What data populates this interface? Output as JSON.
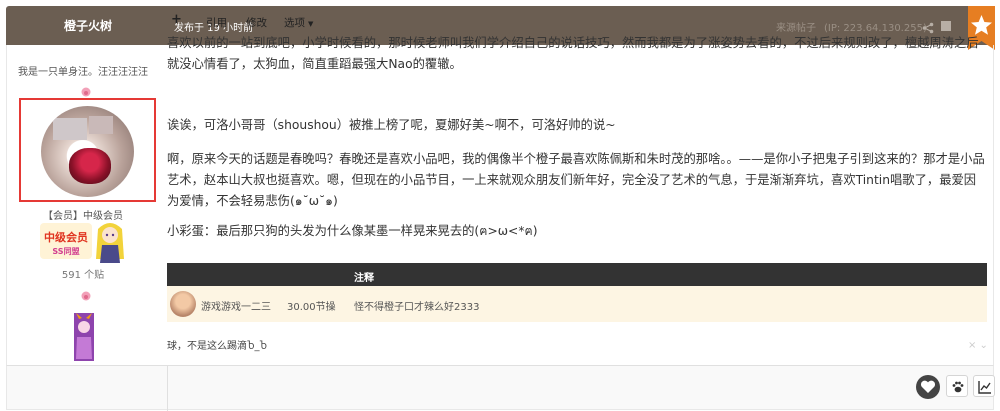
{
  "header": {
    "author": "橙子火树",
    "posted": "发布于 19 小时前",
    "source": "来源帖子",
    "ip": "(IP: 223.64.130.255)",
    "icons": [
      "share-icon",
      "square-icon",
      "bookmark-star-icon"
    ],
    "bookmark_color": "#e67e22",
    "bar_color": "#6b5e52"
  },
  "user": {
    "title": "我是一只单身汪。汪汪汪汪汪",
    "group_prefix": "【会员】",
    "level": "中级会员",
    "rank_badge_text": "中级会员",
    "rank_badge_sub": "SS同盟",
    "posts": "591 个贴",
    "avatar_highlight_color": "#e53935"
  },
  "post": {
    "p1": "喜欢以前的一站到底吧，小学时候看的，那时候老师叫我们学介绍自己的说话技巧，然而我都是为了涨姿势去看的，不过后来规则改了，檀越周涛之后就没心情看了，太狗血，简直重蹈最强大Nao的覆辙。",
    "p2": "诶诶，可洛小哥哥（shoushou）被推上榜了呢，夏娜好美~啊不，可洛好帅的说~",
    "p3": "啊，原来今天的话题是春晚吗？春晚还是喜欢小品吧，我的偶像半个橙子最喜欢陈佩斯和朱时茂的那啥。。——是你小子把鬼子引到这来的？那才是小品艺术，赵本山大叔也挺喜欢。嗯，但现在的小品节目，一上来就观众朋友们新年好，完全没了艺术的气息，于是渐渐弃坑，喜欢Tintin唱歌了，最爱因为爱情，不会轻易悲伤(๑˘ω˘๑)",
    "p4": "小彩蛋：最后那只狗的头发为什么像某墨一样晃来晃去的(ฅ>ω<*ฅ)"
  },
  "rating": {
    "header": "注释",
    "rows": [
      {
        "user": "游戏游戏一二三",
        "score": "30.00节操",
        "reason": "怪不得橙子口才辣么好2333"
      }
    ]
  },
  "signature": "球，不是这么踢滴Ⴆ_Ⴆ",
  "toolbar": {
    "add": "+",
    "quote": "引用",
    "edit": "修改",
    "options": "选项",
    "right_icons": [
      "heart-icon",
      "paw-icon",
      "chart-icon"
    ]
  }
}
